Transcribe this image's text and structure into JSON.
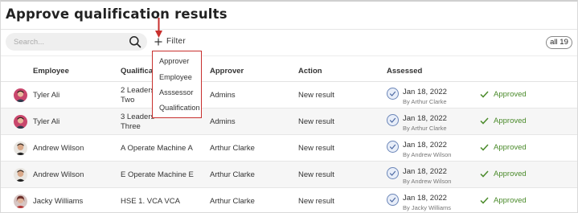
{
  "page": {
    "title": "Approve qualification results"
  },
  "toolbar": {
    "search_placeholder": "Search...",
    "filter_label": "Filter",
    "count_label": "all 19"
  },
  "filter_menu": {
    "items": [
      "Approver",
      "Employee",
      "Asssessor",
      "Qualification"
    ]
  },
  "table": {
    "headers": {
      "employee": "Employee",
      "qualification": "Qualificat",
      "approver": "Approver",
      "action": "Action",
      "assessed": "Assessed"
    },
    "rows": [
      {
        "employee": "Tyler Ali",
        "qual_line1": "2 Leaders",
        "qual_line2": "Two",
        "approver": "Admins",
        "action": "New result",
        "date": "Jan 18, 2022",
        "by": "By Arthur Clarke",
        "status": "Approved"
      },
      {
        "employee": "Tyler Ali",
        "qual_line1": "3 Leaders",
        "qual_line2": "Three",
        "approver": "Admins",
        "action": "New result",
        "date": "Jan 18, 2022",
        "by": "By Arthur Clarke",
        "status": "Approved"
      },
      {
        "employee": "Andrew Wilson",
        "qual_line1": "A Operate Machine A",
        "qual_line2": "",
        "approver": "Arthur Clarke",
        "action": "New result",
        "date": "Jan 18, 2022",
        "by": "By Andrew Wilson",
        "status": "Approved"
      },
      {
        "employee": "Andrew Wilson",
        "qual_line1": "E Operate Machine E",
        "qual_line2": "",
        "approver": "Arthur Clarke",
        "action": "New result",
        "date": "Jan 18, 2022",
        "by": "By Andrew Wilson",
        "status": "Approved"
      },
      {
        "employee": "Jacky Williams",
        "qual_line1": "HSE 1. VCA VCA",
        "qual_line2": "",
        "approver": "Arthur Clarke",
        "action": "New result",
        "date": "Jan 18, 2022",
        "by": "By Jacky Williams",
        "status": "Approved"
      }
    ]
  },
  "colors": {
    "accent_red": "#c8302e",
    "approved_green": "#4a8a2a",
    "check_blue": "#6b86b8"
  },
  "icons": {
    "search": "search-icon",
    "filter": "plus-icon",
    "pointer": "arrow-down-icon",
    "assessed": "check-circle-icon",
    "status": "checkmark-icon"
  }
}
